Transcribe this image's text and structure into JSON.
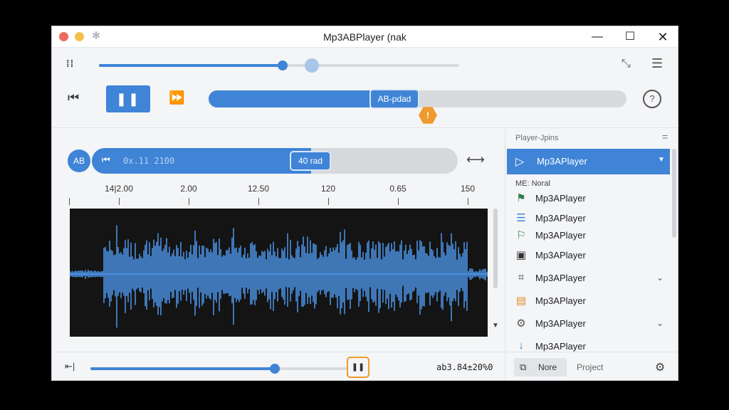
{
  "window": {
    "title": "Mp3ABPlayer (nak"
  },
  "toolbar": {
    "grip": "⁞⁞",
    "seek_progress": 0.51,
    "seek_hover": 0.59,
    "right_icons": [
      "collapse-icon",
      "menu-icon"
    ]
  },
  "transport": {
    "prev": "⏮",
    "play_pause": "❚❚",
    "fast_forward": "⏩",
    "ab_progress": 0.51,
    "ab_marker_label": "AB-pdad",
    "hex_marker": "!",
    "help": "?"
  },
  "loop": {
    "badge": "AB",
    "time": "0x.11 2100",
    "marker_label": "40 rad",
    "progress": 0.6
  },
  "ruler": {
    "labels": [
      "14|2.00",
      "2.00",
      "12.50",
      "120",
      "0.65",
      "150"
    ]
  },
  "bottom": {
    "start_icon": "⇤|",
    "progress": 0.72,
    "pause_label": "❚❚",
    "time_readout": "ab3.84±20%0"
  },
  "sidebar": {
    "header": "Player-Jpins",
    "selected": {
      "label": "Mp3APlayer"
    },
    "sub_label": "ME: Noral",
    "items": [
      {
        "label": "Mp3APlayer",
        "icon": "flag-icon",
        "glyph": "⚑",
        "color": "#2e7d4f"
      },
      {
        "label": "Mp3APlayer",
        "icon": "list-icon",
        "glyph": "☰",
        "color": "#3f84d6"
      },
      {
        "label": "Mp3APlayer",
        "icon": "flag-outline-icon",
        "glyph": "⚐",
        "color": "#2e7d4f"
      },
      {
        "label": "Mp3APlayer",
        "icon": "window-icon",
        "glyph": "▣",
        "color": "#333333"
      },
      {
        "label": "Mp3APlayer",
        "icon": "crop-icon",
        "glyph": "⌗",
        "color": "#333333",
        "chevron": true
      },
      {
        "label": "Mp3APlayer",
        "icon": "bars-icon",
        "glyph": "▤",
        "color": "#e08a2a"
      },
      {
        "label": "Mp3APlayer",
        "icon": "gear-icon",
        "glyph": "⚙",
        "color": "#555555",
        "chevron": true
      },
      {
        "label": "Mp3APlayer",
        "icon": "arrow-down-icon",
        "glyph": "↓",
        "color": "#3f84d6"
      }
    ],
    "footer": {
      "tab_active": "Nore",
      "tab_other": "Project"
    }
  }
}
